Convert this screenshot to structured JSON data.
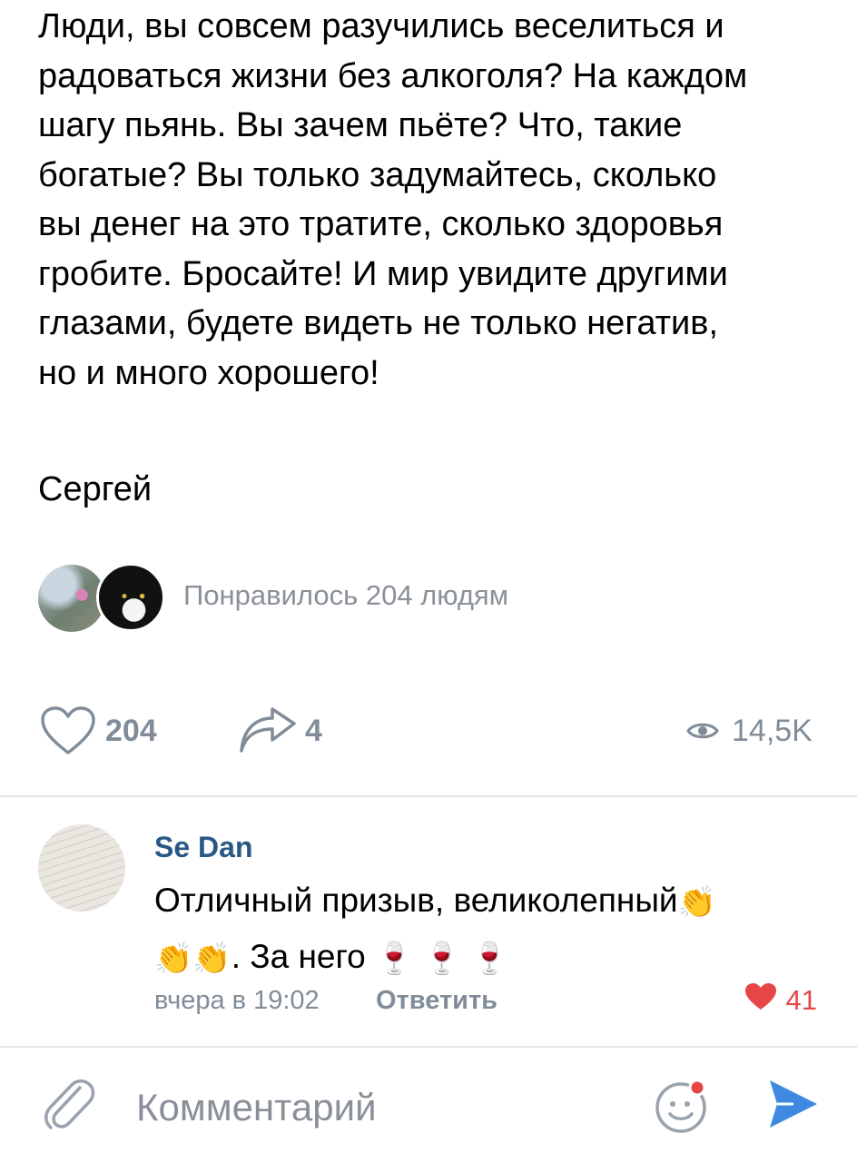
{
  "post": {
    "text": "Люди, вы совсем разучились веселиться и\nрадоваться жизни без алкоголя? На каждом\nшагу пьянь. Вы зачем пьёте? Что, такие\nбогатые? Вы только задумайтесь, сколько\nвы денег на это тратите, сколько здоровья\nгробите. Бросайте! И мир увидите другими\nглазами, будете видеть не только негатив,\nно и много хорошего!",
    "signature": "Сергей",
    "likers_text": "Понравилось 204 людям"
  },
  "actions": {
    "likes": "204",
    "shares": "4",
    "views": "14,5K"
  },
  "comment": {
    "author": "Se Dan",
    "text_part1": "Отличный призыв, великолепный",
    "text_part2": ". За него",
    "clap_emoji": "👏",
    "wine_emoji": "🍷",
    "time": "вчера в 19:02",
    "reply_label": "Ответить",
    "likes": "41"
  },
  "composer": {
    "placeholder": "Комментарий"
  },
  "colors": {
    "accent": "#2a5885",
    "muted": "#818c99",
    "like_red": "#e64646",
    "send_blue": "#3f8ae0"
  }
}
